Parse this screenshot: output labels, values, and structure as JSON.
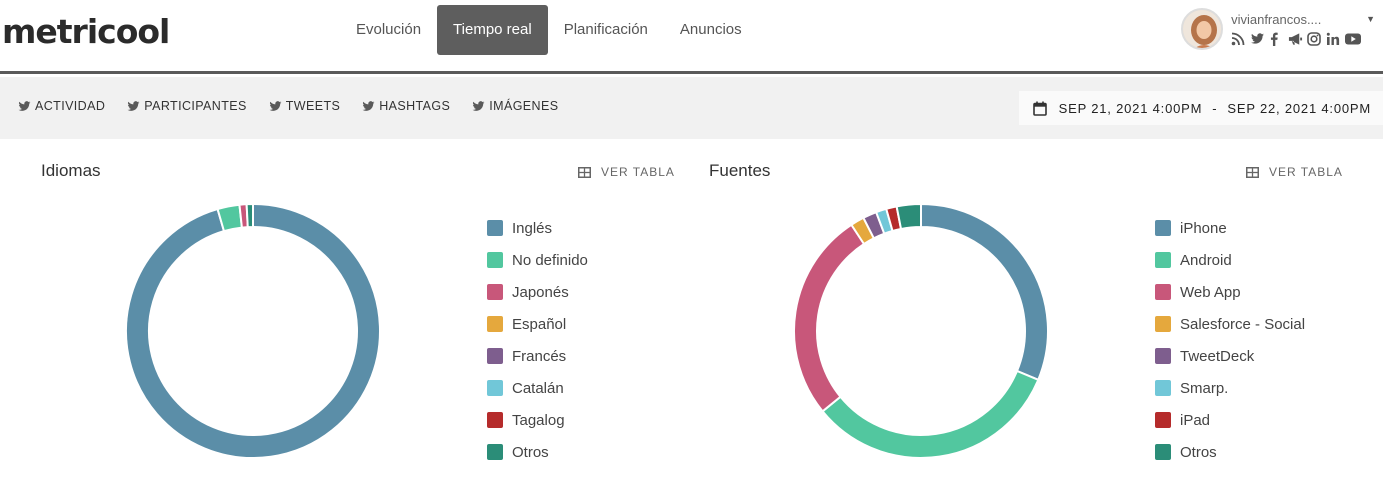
{
  "brand": {
    "logo": "metricool"
  },
  "nav": [
    {
      "label": "Evolución",
      "active": false
    },
    {
      "label": "Tiempo real",
      "active": true
    },
    {
      "label": "Planificación",
      "active": false
    },
    {
      "label": "Anuncios",
      "active": false
    }
  ],
  "user": {
    "name": "vivianfrancos....",
    "social_icons": [
      "rss-icon",
      "twitter-icon",
      "facebook-icon",
      "megaphone-icon",
      "instagram-icon",
      "linkedin-icon",
      "youtube-icon"
    ]
  },
  "subnav": {
    "tabs": [
      "ACTIVIDAD",
      "PARTICIPANTES",
      "TWEETS",
      "HASHTAGS",
      "IMÁGENES"
    ],
    "date_from": "SEP 21, 2021 4:00PM",
    "date_sep": "-",
    "date_to": "SEP 22, 2021 4:00PM"
  },
  "panels": {
    "idiomas": {
      "title": "Idiomas",
      "ver_tabla": "VER TABLA",
      "legend": [
        {
          "label": "Inglés",
          "color": "#5b8ea8"
        },
        {
          "label": "No definido",
          "color": "#52c79f"
        },
        {
          "label": "Japonés",
          "color": "#c8577a"
        },
        {
          "label": "Español",
          "color": "#e5a83d"
        },
        {
          "label": "Francés",
          "color": "#7e5e8e"
        },
        {
          "label": "Catalán",
          "color": "#71c7d8"
        },
        {
          "label": "Tagalog",
          "color": "#b52b2b"
        },
        {
          "label": "Otros",
          "color": "#2b8d78"
        }
      ]
    },
    "fuentes": {
      "title": "Fuentes",
      "ver_tabla": "VER TABLA",
      "legend": [
        {
          "label": "iPhone",
          "color": "#5b8ea8"
        },
        {
          "label": "Android",
          "color": "#52c79f"
        },
        {
          "label": "Web App",
          "color": "#c8577a"
        },
        {
          "label": "Salesforce - Social",
          "color": "#e5a83d"
        },
        {
          "label": "TweetDeck",
          "color": "#7e5e8e"
        },
        {
          "label": "Smarp.",
          "color": "#71c7d8"
        },
        {
          "label": "iPad",
          "color": "#b52b2b"
        },
        {
          "label": "Otros",
          "color": "#2b8d78"
        }
      ]
    }
  },
  "chart_data": [
    {
      "type": "pie",
      "categories": [
        "Inglés",
        "No definido",
        "Japonés",
        "Español",
        "Francés",
        "Catalán",
        "Tagalog",
        "Otros"
      ],
      "values": [
        95.5,
        2.8,
        0.9,
        0,
        0,
        0,
        0,
        0.8
      ],
      "legend": "right"
    },
    {
      "type": "pie",
      "categories": [
        "iPhone",
        "Android",
        "Web App",
        "Salesforce - Social",
        "TweetDeck",
        "Smarp.",
        "iPad",
        "Otros"
      ],
      "values": [
        30.5,
        32.0,
        26.0,
        1.7,
        1.7,
        1.3,
        1.3,
        3.0
      ],
      "legend": "right"
    }
  ]
}
